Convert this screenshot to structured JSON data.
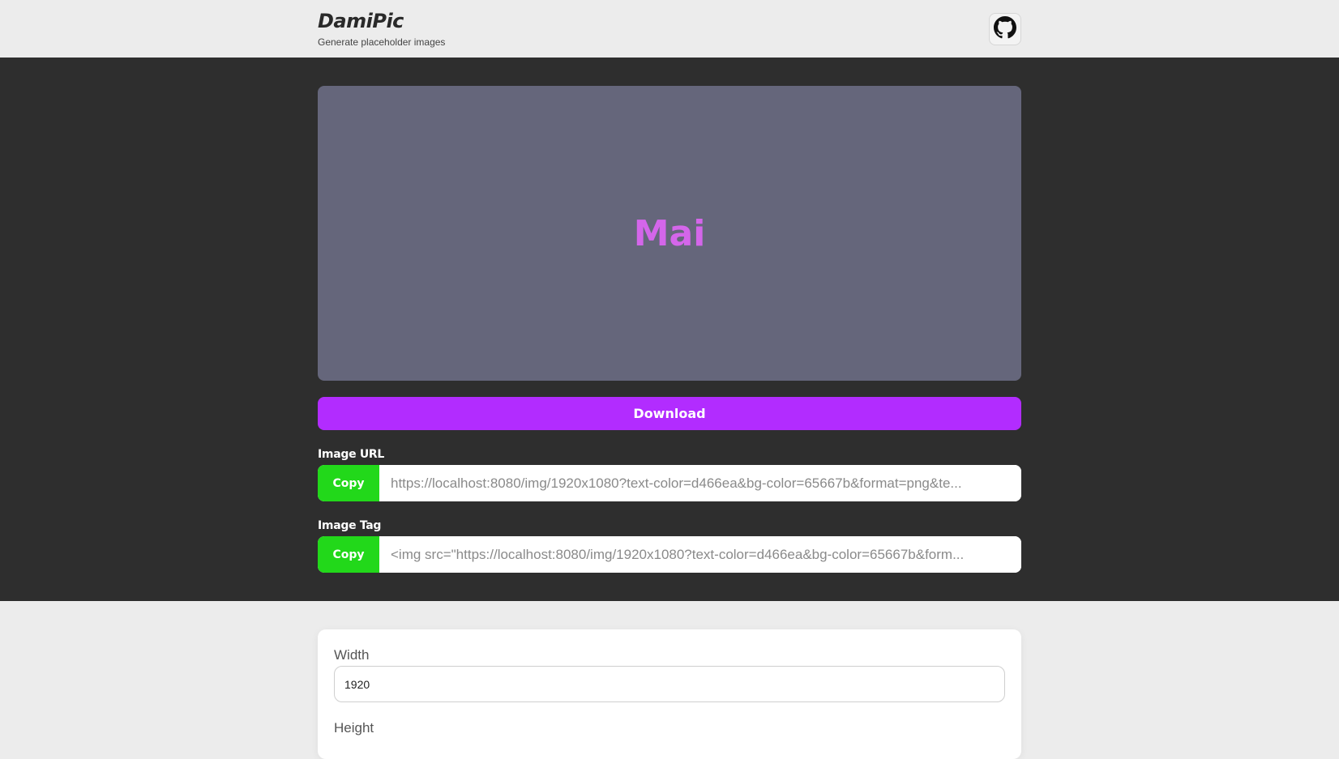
{
  "header": {
    "title": "DamiPic",
    "subtitle": "Generate placeholder images",
    "github_icon": "github-icon"
  },
  "preview": {
    "text": "Mai",
    "bg_color": "#65667b",
    "text_color": "#d466ea"
  },
  "actions": {
    "download_label": "Download",
    "download_color": "#b22cff"
  },
  "image_url": {
    "label": "Image URL",
    "copy_label": "Copy",
    "value": "https://localhost:8080/img/1920x1080?text-color=d466ea&bg-color=65667b&format=png&te..."
  },
  "image_tag": {
    "label": "Image Tag",
    "copy_label": "Copy",
    "value": "<img src=\"https://localhost:8080/img/1920x1080?text-color=d466ea&bg-color=65667b&form..."
  },
  "copy_color": "#22d81a",
  "settings": {
    "width_label": "Width",
    "width_value": "1920",
    "height_label": "Height"
  }
}
